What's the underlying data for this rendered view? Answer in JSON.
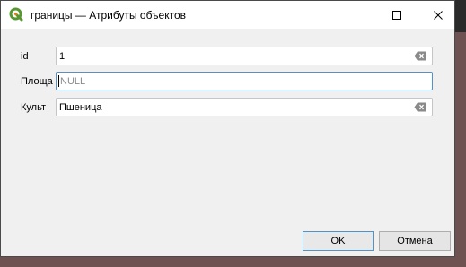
{
  "window": {
    "title": "границы — Атрибуты объектов",
    "icon": "qgis-icon"
  },
  "form": {
    "fields": [
      {
        "label": "id",
        "value": "1",
        "placeholder": "",
        "clearable": true
      },
      {
        "label": "Площа",
        "value": "",
        "placeholder": "NULL",
        "clearable": false
      },
      {
        "label": "Культ",
        "value": "Пшеница",
        "placeholder": "",
        "clearable": true
      }
    ]
  },
  "buttons": {
    "ok": "OK",
    "cancel": "Отмена"
  },
  "colors": {
    "accent": "#4f93c8",
    "qgis_green": "#589632",
    "qgis_yellow": "#ee7913"
  }
}
